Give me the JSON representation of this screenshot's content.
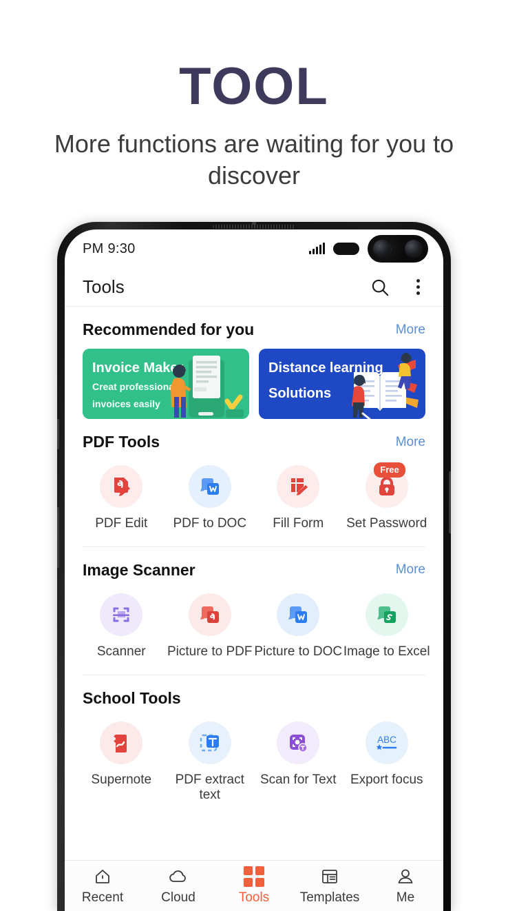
{
  "promo": {
    "title": "TOOL",
    "subtitle": "More functions are waiting for you to discover",
    "title_color": "#3d3a5c"
  },
  "status_bar": {
    "time": "PM 9:30",
    "signal_icon": "cellular-signal-icon",
    "battery_icon": "battery-full-icon"
  },
  "app_bar": {
    "title": "Tools",
    "search_icon": "search-icon",
    "overflow_icon": "more-vertical-icon"
  },
  "sections": [
    {
      "title": "Recommended for you",
      "more_label": "More",
      "banners": [
        {
          "headline": "Invoice Maker",
          "sub_line_1": "Creat professional",
          "sub_line_2": "invoices easily",
          "color": "#32c08a",
          "art": "invoice-illustration"
        },
        {
          "headline": "Distance learning",
          "sub_line_1": "Solutions",
          "sub_line_2": "",
          "color": "#1f48c4",
          "art": "distance-learning-illustration"
        }
      ]
    },
    {
      "title": "PDF Tools",
      "more_label": "More",
      "tools": [
        {
          "label": "PDF Edit",
          "icon": "pdf-edit-icon",
          "bg": "#fdeceb",
          "fg": "#e8503a",
          "badge": ""
        },
        {
          "label": "PDF to DOC",
          "icon": "pdf-to-doc-icon",
          "bg": "#e4f0fd",
          "fg": "#2c7ef0",
          "badge": ""
        },
        {
          "label": "Fill Form",
          "icon": "fill-form-icon",
          "bg": "#fdeceb",
          "fg": "#e8503a",
          "badge": ""
        },
        {
          "label": "Set Password",
          "icon": "lock-icon",
          "bg": "#fdeeed",
          "fg": "#e8503a",
          "badge": "Free"
        }
      ]
    },
    {
      "title": "Image Scanner",
      "more_label": "More",
      "tools": [
        {
          "label": "Scanner",
          "icon": "scanner-icon",
          "bg": "# efe9fb",
          "fg": "#8a6fe0",
          "badge": ""
        },
        {
          "label": "Picture to PDF",
          "icon": "picture-to-pdf-icon",
          "bg": "#fbeae9",
          "fg": "#d9453c",
          "badge": ""
        },
        {
          "label": "Picture to DOC",
          "icon": "picture-to-doc-icon",
          "bg": "#e2eefc",
          "fg": "#2c7ef0",
          "badge": ""
        },
        {
          "label": "Image to Excel",
          "icon": "image-to-excel-icon",
          "bg": "#e4f7ef",
          "fg": "#14a35e",
          "badge": ""
        }
      ]
    },
    {
      "title": "School Tools",
      "more_label": "",
      "tools": [
        {
          "label": "Supernote",
          "icon": "supernote-icon",
          "bg": "#fbeae9",
          "fg": "#e8503a",
          "badge": ""
        },
        {
          "label": "PDF extract text",
          "icon": "pdf-extract-text-icon",
          "bg": "#e7f1fb",
          "fg": "#2c7ef0",
          "badge": ""
        },
        {
          "label": "Scan for Text",
          "icon": "scan-for-text-icon",
          "bg": "#f1ebfb",
          "fg": "#8b4fd6",
          "badge": ""
        },
        {
          "label": "Export focus",
          "icon": "abc-icon",
          "bg": "#e5f1fb",
          "fg": "#2c7ef0",
          "badge": ""
        }
      ]
    }
  ],
  "bottom_nav": {
    "active_color": "#f2603c",
    "items": [
      {
        "label": "Recent",
        "icon": "home-icon",
        "active": false
      },
      {
        "label": "Cloud",
        "icon": "cloud-icon",
        "active": false
      },
      {
        "label": "Tools",
        "icon": "grid-icon",
        "active": true
      },
      {
        "label": "Templates",
        "icon": "templates-icon",
        "active": false
      },
      {
        "label": "Me",
        "icon": "person-icon",
        "active": false
      }
    ]
  }
}
